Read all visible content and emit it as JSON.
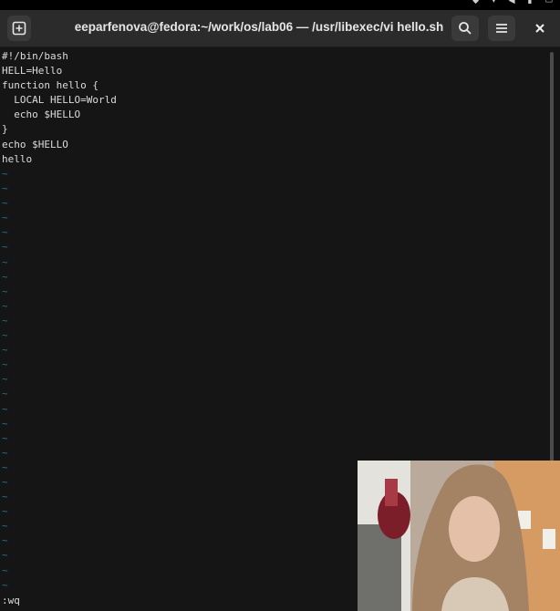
{
  "window": {
    "title": "eeparfenova@fedora:~/work/os/lab06 — /usr/libexec/vi hello.sh"
  },
  "editor": {
    "lines": [
      "#!/bin/bash",
      "HELL=Hello",
      "function hello {",
      "  LOCAL HELLO=World",
      "  echo $HELLO",
      "}",
      "echo $HELLO",
      "hello"
    ],
    "empty_line_marker": "~",
    "empty_line_count": 29,
    "command_line": ":wq"
  },
  "icons": {
    "new_tab": "new-tab-icon",
    "search": "search-icon",
    "menu": "hamburger-menu-icon",
    "close": "close-icon"
  },
  "colors": {
    "terminal_bg": "#151515",
    "titlebar_bg": "#2b2b2b",
    "text": "#dcdcdc",
    "tilde": "#2f6d86"
  }
}
